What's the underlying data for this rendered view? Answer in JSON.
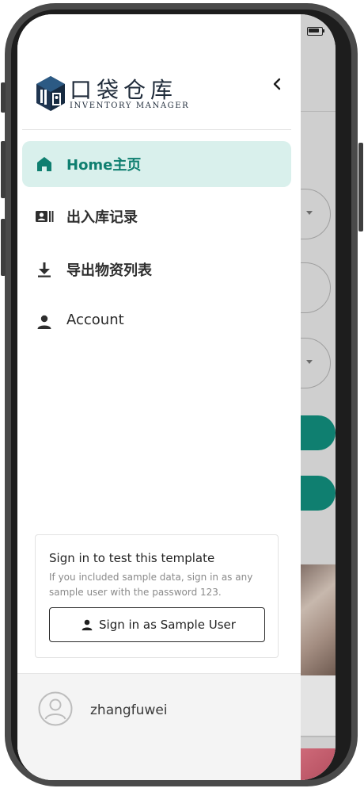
{
  "app": {
    "logo_title": "口袋仓库",
    "logo_subtitle": "Inventory Manager",
    "logo_subtitle_display": "INVENTORY MANAGER"
  },
  "drawer": {
    "collapse_icon": "chevron-left-icon",
    "nav": [
      {
        "label": "Home主页",
        "icon": "home-icon",
        "active": true
      },
      {
        "label": "出入库记录",
        "icon": "contact-card-icon",
        "active": false
      },
      {
        "label": "导出物资列表",
        "icon": "download-icon",
        "active": false
      },
      {
        "label": "Account",
        "icon": "person-icon",
        "active": false
      }
    ]
  },
  "signin": {
    "title": "Sign in to test this template",
    "description": "If you included sample data, sign in as any sample user with the password 123.",
    "button_label": "Sign in as Sample User",
    "button_icon": "person-icon"
  },
  "user": {
    "name": "zhangfuwei",
    "avatar_icon": "account-circle-icon"
  },
  "colors": {
    "accent": "#0f7f70",
    "active_bg": "#d9f0ec",
    "backdrop": "#cfcfcf"
  }
}
